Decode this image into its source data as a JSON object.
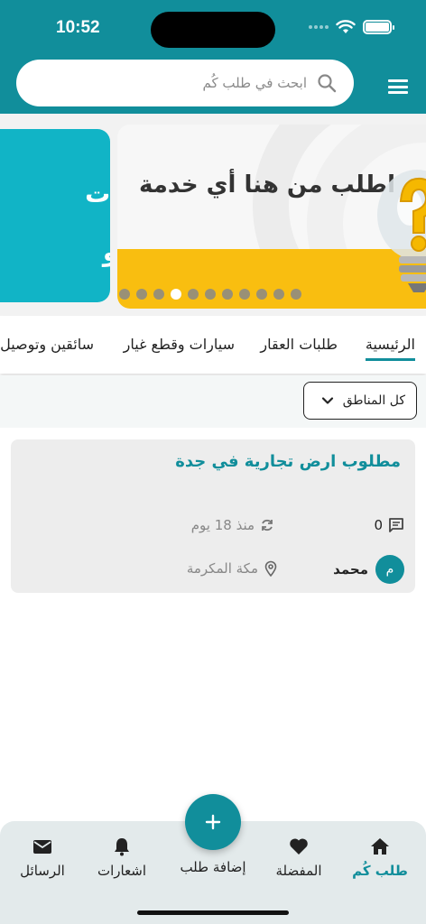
{
  "status_bar": {
    "time": "10:52"
  },
  "search": {
    "placeholder": "ابحث في طلب كُم"
  },
  "banner": {
    "title": "اطلب من هنا أي خدمة",
    "prev_line1": "طلبات",
    "prev_line2": "تو",
    "page_count": 11,
    "active_index": 3
  },
  "tabs": [
    "الرئيسية",
    "طلبات العقار",
    "سيارات وقطع غيار",
    "سائقين وتوصيل"
  ],
  "filter": {
    "region_label": "كل المناطق"
  },
  "request_card": {
    "title": "مطلوب ارض تجارية في جدة",
    "comment_count": "0",
    "time_ago": "منذ 18 يوم",
    "user_initial": "م",
    "user_name": "محمد",
    "location": "مكة المكرمة"
  },
  "bottom_nav": {
    "home": "طلب كُم",
    "favorites": "المفضلة",
    "add_request": "إضافة طلب",
    "notifications": "اشعارات",
    "messages": "الرسائل"
  },
  "colors": {
    "primary": "#118e9b",
    "banner_yellow": "#f9be10",
    "banner_teal": "#11b4c6"
  }
}
